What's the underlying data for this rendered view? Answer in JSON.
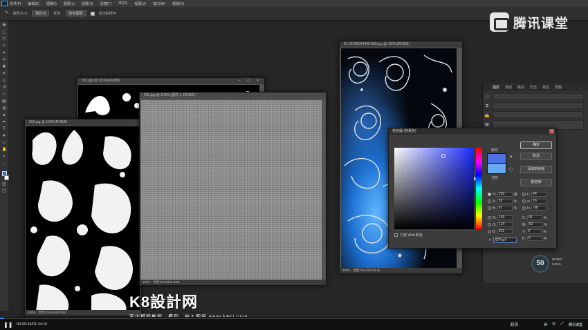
{
  "menubar": {
    "items": [
      "文件(F)",
      "编辑(E)",
      "图像(I)",
      "图层(L)",
      "选择(S)",
      "滤镜(T)",
      "3D(D)",
      "视图(V)",
      "窗口(W)",
      "帮助(H)"
    ]
  },
  "options": {
    "sample_size_label": "取样大小:",
    "sample_size_value": "取样点",
    "sample_label": "样本:",
    "sample_value": "所有图层",
    "show_ring_label": "显示取样环"
  },
  "brand": {
    "tencent_classroom": "腾讯课堂"
  },
  "documents": {
    "doc_back": {
      "title": "001.jpg @ 100%(RGB/8)"
    },
    "doc_left": {
      "title": "002.jpg @ 100%(RGB/8)",
      "zoom": "100%",
      "status": "文档:979.6K/979.6K"
    },
    "doc_linen": {
      "title": "003.jpg @ 100% (图层 1, RGB/8) *",
      "zoom": "100%",
      "status": "文档:976.9K/1.93M"
    },
    "doc_blue": {
      "title": "01-01980044436-009.jpg @ 100%(RGB/8)",
      "zoom": "100%",
      "status": "文档:764.6K/764.6K"
    }
  },
  "layers_panel": {
    "tabs": [
      "图层",
      "通道",
      "路径",
      "历史",
      "属性",
      "调整"
    ]
  },
  "color_picker": {
    "title": "拾色器 (前景色)",
    "new_label": "新的",
    "current_label": "当前",
    "ok": "确定",
    "cancel": "取消",
    "add_swatch": "添加到色板",
    "libraries": "颜色库",
    "web_only": "只有 Web 颜色",
    "hex_prefix": "#",
    "hex": "677ce7",
    "colors": {
      "new": "#4d73e3",
      "current": "#67aaf0"
    },
    "fields": {
      "H": "230",
      "H_unit": "度",
      "S": "55",
      "S_unit": "%",
      "B": "91",
      "B_unit": "%",
      "R": "103",
      "G": "124",
      "Bl": "231",
      "L": "54",
      "a": "16",
      "b": "-58",
      "C": "66",
      "C_unit": "%",
      "M": "52",
      "M_unit": "%",
      "Y": "0",
      "Y_unit": "%",
      "K": "0",
      "K_unit": "%"
    }
  },
  "overlay": {
    "zoom_badge": "50",
    "net_up": "60.5K/s",
    "net_down": "0.9K/s"
  },
  "watermark": {
    "title": "K8設計网",
    "subtitle": "室内模版教程、模型、施工图纸 www.k8sj.com"
  },
  "player": {
    "time": "00:00:34/01:24:16",
    "progress_fraction": 0.007,
    "quality": "超清",
    "brand": "腾讯课堂"
  }
}
